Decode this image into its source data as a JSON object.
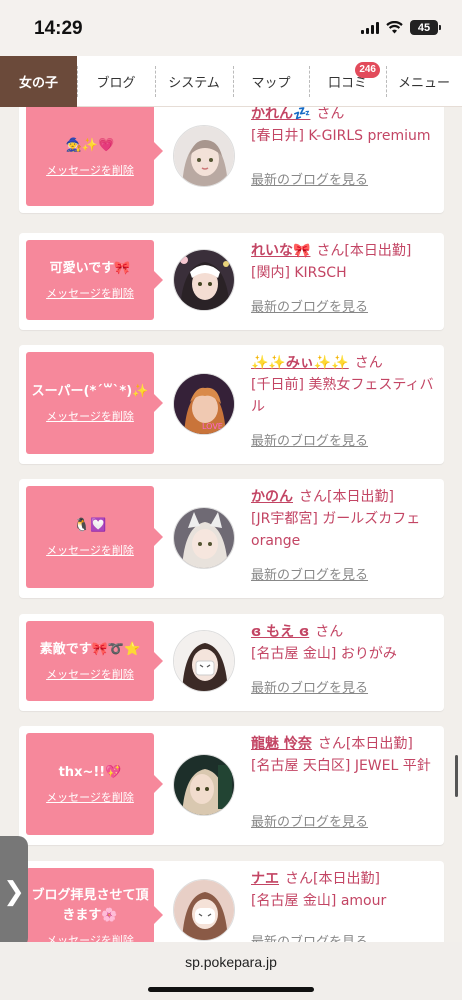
{
  "status": {
    "time": "14:29",
    "battery": "45"
  },
  "nav": {
    "items": [
      {
        "label": "女の子",
        "active": true
      },
      {
        "label": "ブログ"
      },
      {
        "label": "システム"
      },
      {
        "label": "マップ"
      },
      {
        "label": "口コミ",
        "badge": "246"
      },
      {
        "label": "メニュー"
      }
    ]
  },
  "cards": [
    {
      "message": "🧙✨💗",
      "delete_label": "メッセージを削除",
      "name": "かれん💤",
      "san": "さん",
      "shop": "[春日井] K-GIRLS premium",
      "blog_link": "最新のブログを見る"
    },
    {
      "message": "可愛いです🎀",
      "delete_label": "メッセージを削除",
      "name": "れいな🎀",
      "san": "さん[本日出勤]",
      "shop": "[関内] KIRSCH",
      "blog_link": "最新のブログを見る"
    },
    {
      "message": "スーパー(*´꒳`*)✨",
      "delete_label": "メッセージを削除",
      "name": "✨✨みぃ✨✨",
      "san": "さん",
      "shop": "[千日前] 美熟女フェスティバル",
      "blog_link": "最新のブログを見る"
    },
    {
      "message": "🐧💟",
      "delete_label": "メッセージを削除",
      "name": "かのん",
      "san": "さん[本日出勤]",
      "shop": "[JR宇都宮] ガールズカフェ orange",
      "blog_link": "最新のブログを見る"
    },
    {
      "message": "素敵です🎀➰⭐",
      "delete_label": "メッセージを削除",
      "name": "ɞ もえ ɞ",
      "san": "さん",
      "shop": "[名古屋 金山] おりがみ",
      "blog_link": "最新のブログを見る"
    },
    {
      "message": "thx~!!💖",
      "delete_label": "メッセージを削除",
      "name": "龍魅 怜奈",
      "san": "さん[本日出勤]",
      "shop": "[名古屋 天白区] JEWEL 平針",
      "blog_link": "最新のブログを見る"
    },
    {
      "message": "ブログ拝見させて頂きます🌸",
      "delete_label": "メッセージを削除",
      "name": "ナエ",
      "san": "さん[本日出勤]",
      "shop": "[名古屋 金山] amour",
      "blog_link": "最新のブログを見る"
    }
  ],
  "side_tab": {
    "icon": "chevron-right-icon",
    "glyph": "❯"
  },
  "browser": {
    "url": "sp.pokepara.jp"
  },
  "colors": {
    "accent": "#c34564",
    "message_bg": "#f6889b",
    "nav_active": "#6b4a3a"
  }
}
